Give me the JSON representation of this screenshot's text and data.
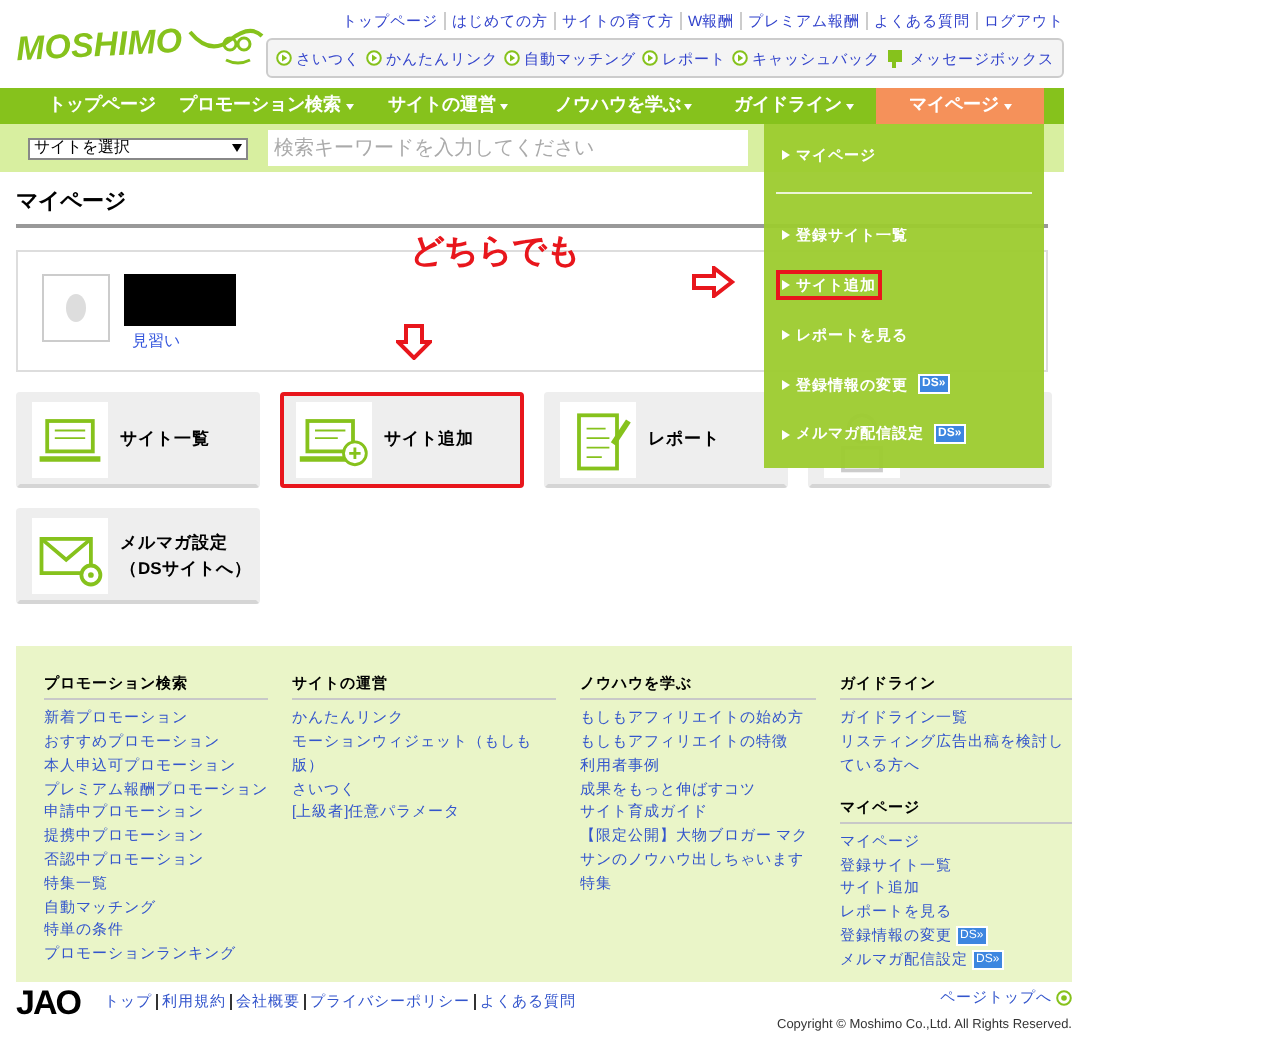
{
  "logo": {
    "text": "MOSHIMO"
  },
  "top_links": [
    "トップページ",
    "はじめての方",
    "サイトの育て方",
    "W報酬",
    "プレミアム報酬",
    "よくある質問",
    "ログアウト"
  ],
  "quick_buttons": [
    {
      "label": "さいつく",
      "kind": "play"
    },
    {
      "label": "かんたんリンク",
      "kind": "play"
    },
    {
      "label": "自動マッチング",
      "kind": "play"
    },
    {
      "label": "レポート",
      "kind": "play"
    },
    {
      "label": "キャッシュバック",
      "kind": "play"
    },
    {
      "label": "メッセージボックス",
      "kind": "message"
    }
  ],
  "nav": [
    {
      "label": "トップページ",
      "dropdown": false,
      "selected": false
    },
    {
      "label": "プロモーション検索",
      "dropdown": true,
      "selected": false
    },
    {
      "label": "サイトの運営",
      "dropdown": true,
      "selected": false
    },
    {
      "label": "ノウハウを学ぶ",
      "dropdown": true,
      "selected": false
    },
    {
      "label": "ガイドライン",
      "dropdown": true,
      "selected": false
    },
    {
      "label": "マイページ",
      "dropdown": true,
      "selected": true
    }
  ],
  "search": {
    "select": "サイトを選択",
    "placeholder": "検索キーワードを入力してください"
  },
  "page_title": "マイページ",
  "profile": {
    "rank": "見習い"
  },
  "annotation": {
    "text": "どちらでも"
  },
  "tiles": [
    {
      "lines": [
        "サイト一覧"
      ],
      "kind": "laptop",
      "highlighted": false
    },
    {
      "lines": [
        "サイト追加"
      ],
      "kind": "laptop-add",
      "highlighted": true
    },
    {
      "lines": [
        "レポート"
      ],
      "kind": "report",
      "highlighted": false
    },
    {
      "kind": "person",
      "highlighted": false
    },
    {
      "lines": [
        "メルマガ設定",
        "（DSサイトへ）"
      ],
      "kind": "mail",
      "highlighted": false
    }
  ],
  "dropdown_menu": [
    {
      "label": "マイページ",
      "highlighted": false,
      "divider_after": true
    },
    {
      "label": "登録サイト一覧",
      "highlighted": false
    },
    {
      "label": "サイト追加",
      "highlighted": true
    },
    {
      "label": "レポートを見る",
      "highlighted": false
    },
    {
      "label": "登録情報の変更",
      "badge": "DS»",
      "highlighted": false
    },
    {
      "label": "メルマガ配信設定",
      "badge": "DS»",
      "highlighted": false
    }
  ],
  "footer_columns": [
    {
      "sections": [
        {
          "heading": "プロモーション検索",
          "links": [
            {
              "text": "新着プロモーション"
            },
            {
              "text": "おすすめプロモーション"
            },
            {
              "text": "本人申込可プロモーション"
            },
            {
              "text": "プレミアム報酬プロモーション"
            },
            {
              "text": "申請中プロモーション"
            },
            {
              "text": "提携中プロモーション"
            },
            {
              "text": "否認中プロモーション"
            },
            {
              "text": "特集一覧"
            },
            {
              "text": "自動マッチング"
            },
            {
              "text": "特単の条件"
            },
            {
              "text": "プロモーションランキング"
            }
          ]
        }
      ]
    },
    {
      "sections": [
        {
          "heading": "サイトの運営",
          "links": [
            {
              "text": "かんたんリンク"
            },
            {
              "text": "モーションウィジェット（もしも版）"
            },
            {
              "text": "さいつく"
            },
            {
              "text": "[上級者]任意パラメータ"
            }
          ]
        }
      ]
    },
    {
      "sections": [
        {
          "heading": "ノウハウを学ぶ",
          "links": [
            {
              "text": "もしもアフィリエイトの始め方"
            },
            {
              "text": "もしもアフィリエイトの特徴"
            },
            {
              "text": "利用者事例"
            },
            {
              "text": "成果をもっと伸ばすコツ"
            },
            {
              "text": "サイト育成ガイド"
            },
            {
              "text": "【限定公開】大物ブロガー マクサンのノウハウ出しちゃいます特集"
            }
          ]
        }
      ]
    },
    {
      "sections": [
        {
          "heading": "ガイドライン",
          "links": [
            {
              "text": "ガイドライン一覧"
            },
            {
              "text": "リスティング広告出稿を検討している方へ"
            }
          ]
        },
        {
          "heading": "マイページ",
          "links": [
            {
              "text": "マイページ"
            },
            {
              "text": "登録サイト一覧"
            },
            {
              "text": "サイト追加"
            },
            {
              "text": "レポートを見る"
            },
            {
              "text": "登録情報の変更",
              "badge": "DS»"
            },
            {
              "text": "メルマガ配信設定",
              "badge": "DS»"
            }
          ]
        }
      ]
    }
  ],
  "bottom": {
    "logo": "JAO",
    "links": [
      "トップ",
      "利用規約",
      "会社概要",
      "プライバシーポリシー",
      "よくある質問"
    ],
    "page_top": "ページトップへ",
    "copyright": "Copyright © Moshimo Co.,Ltd. All Rights Reserved."
  }
}
